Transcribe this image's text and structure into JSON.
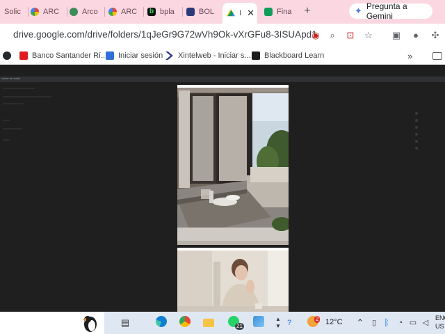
{
  "browser": {
    "tabs": [
      {
        "label": "Solic",
        "favicon": "generic-icon",
        "color": "#c9a0ad"
      },
      {
        "label": "ARC",
        "favicon": "google-icon",
        "color": "#4285f4"
      },
      {
        "label": "Arco",
        "favicon": "globe-icon",
        "color": "#3c8c5a"
      },
      {
        "label": "ARC",
        "favicon": "google-icon",
        "color": "#4285f4"
      },
      {
        "label": "bpla",
        "favicon": "b-icon",
        "color": "#111111"
      },
      {
        "label": "BOL",
        "favicon": "shield-icon",
        "color": "#2d3a7a"
      },
      {
        "label": "I",
        "favicon": "google-drive-icon",
        "color": "#fbbc04",
        "active": true
      },
      {
        "label": "Fina",
        "favicon": "sheet-icon",
        "color": "#0f9d58"
      }
    ],
    "new_tab": "+",
    "close": "✕",
    "gemini_label": "Pregunta a Gemini",
    "url": "drive.google.com/drive/folders/1qJeGr9G72wVh9Ok-vXrGFu8-3ISUApd1"
  },
  "bookmarks": [
    {
      "label": "Banco Santander Rí...",
      "icon": "santander-icon",
      "color": "#e11b22"
    },
    {
      "label": "Iniciar sesión",
      "icon": "mail-icon",
      "color": "#2f6fd6"
    },
    {
      "label": "Xintelweb - Iniciar s...",
      "icon": "chevron-icon",
      "color": "#2b3a8c"
    },
    {
      "label": "Blackboard Learn",
      "icon": "blackboard-icon",
      "color": "#1b1b1b"
    }
  ],
  "viewer": {
    "title": "voicer de audio",
    "pages": [
      {
        "image": "apartment-terrace-photo"
      },
      {
        "image": "woman-kitchen-photo"
      }
    ]
  },
  "taskbar": {
    "temperature": "12°C",
    "whatsapp_badge": "21",
    "weather_badge": "2",
    "lang_line1": "ENG",
    "lang_line2": "US"
  }
}
